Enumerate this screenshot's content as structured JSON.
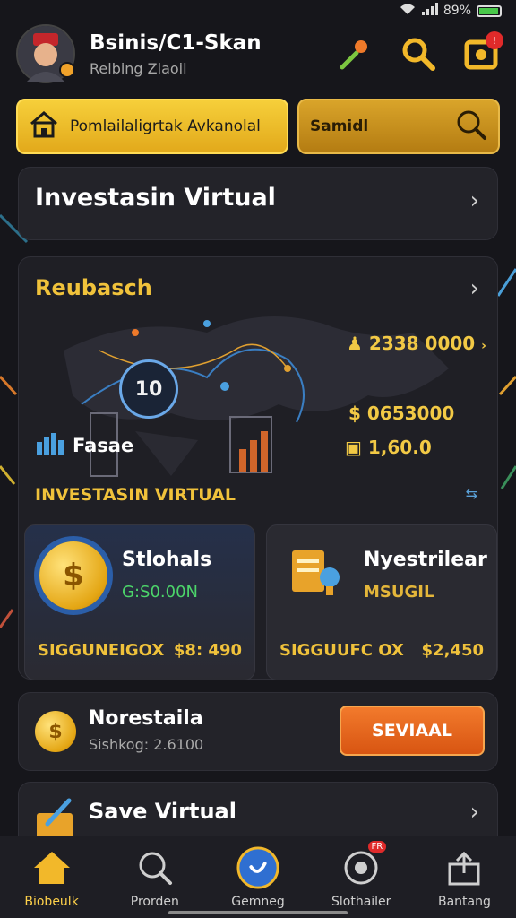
{
  "status_bar": {
    "battery": "89%",
    "battery_level": 0.89
  },
  "header": {
    "user_name": "Bsinis/C1-Skan",
    "user_subtitle": "Relbing Zlaoil"
  },
  "search_row": {
    "primary_button_label": "Pomlailaligrtak Avkanolal",
    "search_text": "Samidl"
  },
  "card_invest": {
    "title": "Investasin Virtual"
  },
  "card_report": {
    "title": "Reubasch",
    "map_badge": "10",
    "stat_1": "2338 0000",
    "stat_2": "$ 0653000",
    "stat_3": "1,60.0",
    "chart_label": "Fasae",
    "section_label": "INVESTASIN VIRTUAL",
    "left_card": {
      "title": "Stlohals",
      "value": "G:S0.00N",
      "foot_label": "SIGGUNEIGOX",
      "foot_value": "$8: 490"
    },
    "right_card": {
      "title": "Nyestrilear",
      "value": "MSUGIL",
      "foot_label": "SIGGUUFC OX",
      "foot_value": "$2,450"
    }
  },
  "card_save_row": {
    "name": "Norestaila",
    "subtitle": "Sishkog: 2.6100",
    "button_label": "SEVIAAL"
  },
  "card_save": {
    "title": "Save Virtual"
  },
  "bottom_nav": {
    "items": [
      {
        "label": "Biobeulk",
        "icon": "home-icon"
      },
      {
        "label": "Prorden",
        "icon": "search-icon"
      },
      {
        "label": "Gemneg",
        "icon": "game-icon"
      },
      {
        "label": "Slothailer",
        "icon": "target-icon",
        "badge": "FR"
      },
      {
        "label": "Bantang",
        "icon": "share-icon"
      }
    ]
  },
  "colors": {
    "accent": "#f0c23b",
    "orange": "#e0611a",
    "background": "#16161b"
  }
}
